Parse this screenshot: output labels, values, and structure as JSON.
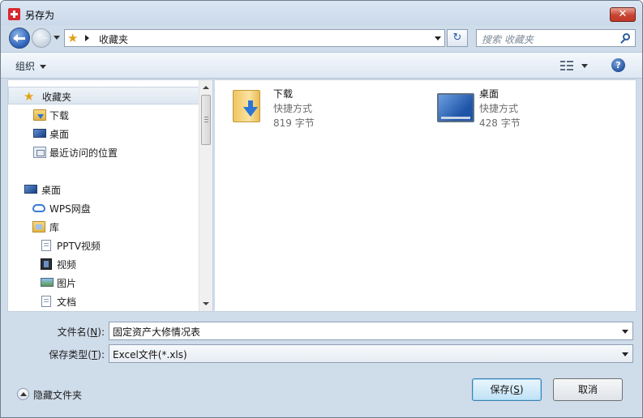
{
  "window": {
    "title": "另存为",
    "close_label": "✕"
  },
  "nav": {
    "address_path": [
      "收藏夹"
    ],
    "search_placeholder": "搜索 收藏夹"
  },
  "toolbar": {
    "organize_label": "组织",
    "help_label": "?"
  },
  "navpane": {
    "items": [
      {
        "label": "收藏夹",
        "icon": "star-icon",
        "selected": true
      },
      {
        "label": "下载",
        "icon": "download-folder-icon"
      },
      {
        "label": "桌面",
        "icon": "desktop-icon"
      },
      {
        "label": "最近访问的位置",
        "icon": "recent-places-icon"
      },
      {
        "label": "桌面",
        "icon": "desktop-icon"
      },
      {
        "label": "WPS网盘",
        "icon": "cloud-icon"
      },
      {
        "label": "库",
        "icon": "library-icon"
      },
      {
        "label": "PPTV视频",
        "icon": "document-icon"
      },
      {
        "label": "视频",
        "icon": "video-icon"
      },
      {
        "label": "图片",
        "icon": "picture-icon"
      },
      {
        "label": "文档",
        "icon": "document-icon"
      }
    ]
  },
  "files": [
    {
      "name": "下载",
      "type": "快捷方式",
      "size": "819 字节",
      "icon": "download-folder-icon"
    },
    {
      "name": "桌面",
      "type": "快捷方式",
      "size": "428 字节",
      "icon": "desktop-icon"
    }
  ],
  "form": {
    "filename_label": "文件名",
    "filename_hotkey": "N",
    "filename_value": "固定资产大修情况表",
    "filetype_label": "保存类型",
    "filetype_hotkey": "T",
    "filetype_value": "Excel文件(*.xls)"
  },
  "footer": {
    "hide_folders_label": "隐藏文件夹",
    "save_label": "保存",
    "save_hotkey": "S",
    "cancel_label": "取消"
  }
}
